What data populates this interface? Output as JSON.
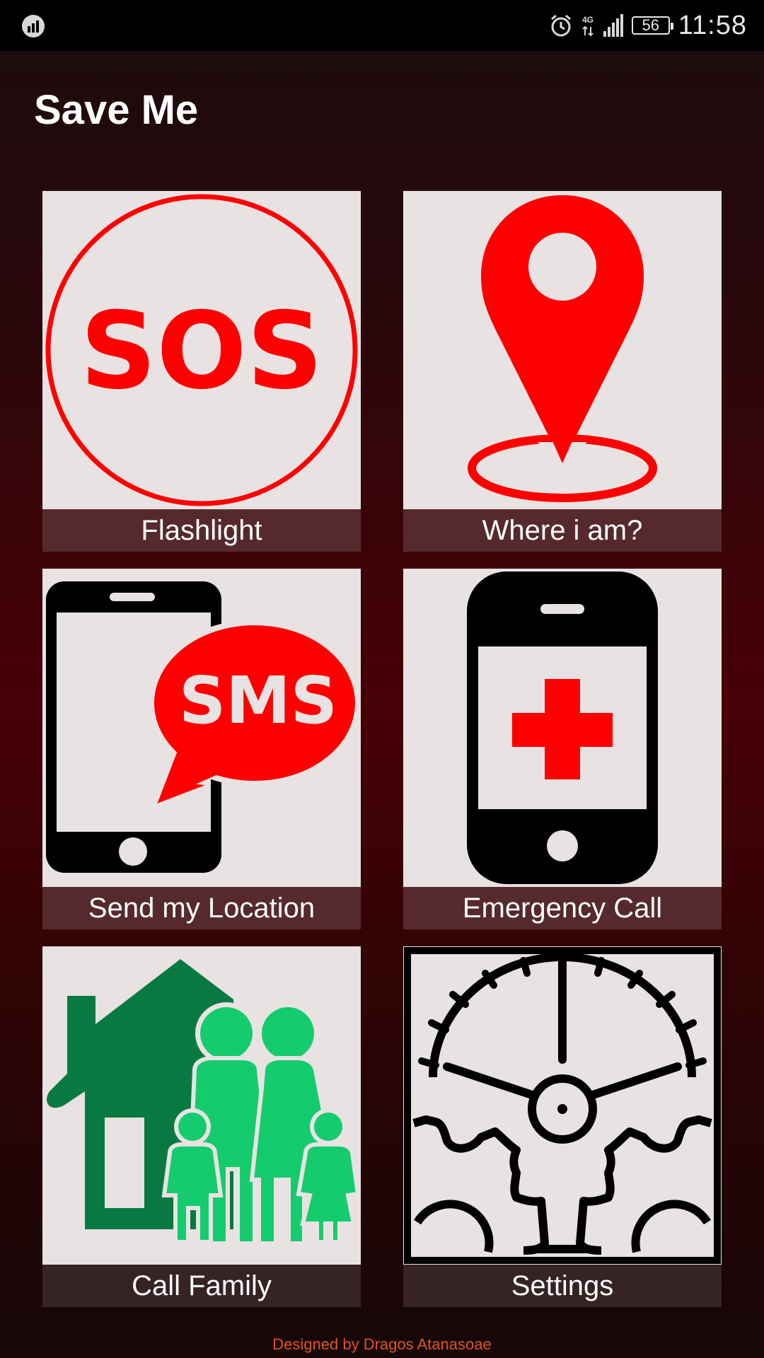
{
  "status_bar": {
    "time": "11:58",
    "battery": "56",
    "network": "4G",
    "icons": [
      "app-status-icon",
      "alarm-icon",
      "network-4g-icon",
      "signal-icon",
      "battery-icon"
    ]
  },
  "app": {
    "title": "Save Me"
  },
  "tiles": [
    {
      "label": "Flashlight",
      "icon": "sos-icon",
      "icon_text": "SOS"
    },
    {
      "label": "Where i am?",
      "icon": "location-pin-icon"
    },
    {
      "label": "Send my Location",
      "icon": "phone-sms-icon",
      "icon_text": "SMS"
    },
    {
      "label": "Emergency Call",
      "icon": "phone-medical-icon"
    },
    {
      "label": "Call Family",
      "icon": "family-house-icon"
    },
    {
      "label": "Settings",
      "icon": "gears-icon"
    }
  ],
  "footer": {
    "credit": "Designed by Dragos Atanasoae"
  },
  "colors": {
    "accent_red": "#ff0000",
    "tile_bg": "#e8e2e2",
    "label_bg": "#562a2c",
    "footer_text": "#e2541e",
    "family_green_dark": "#087a41",
    "family_green_light": "#14cc6e"
  }
}
